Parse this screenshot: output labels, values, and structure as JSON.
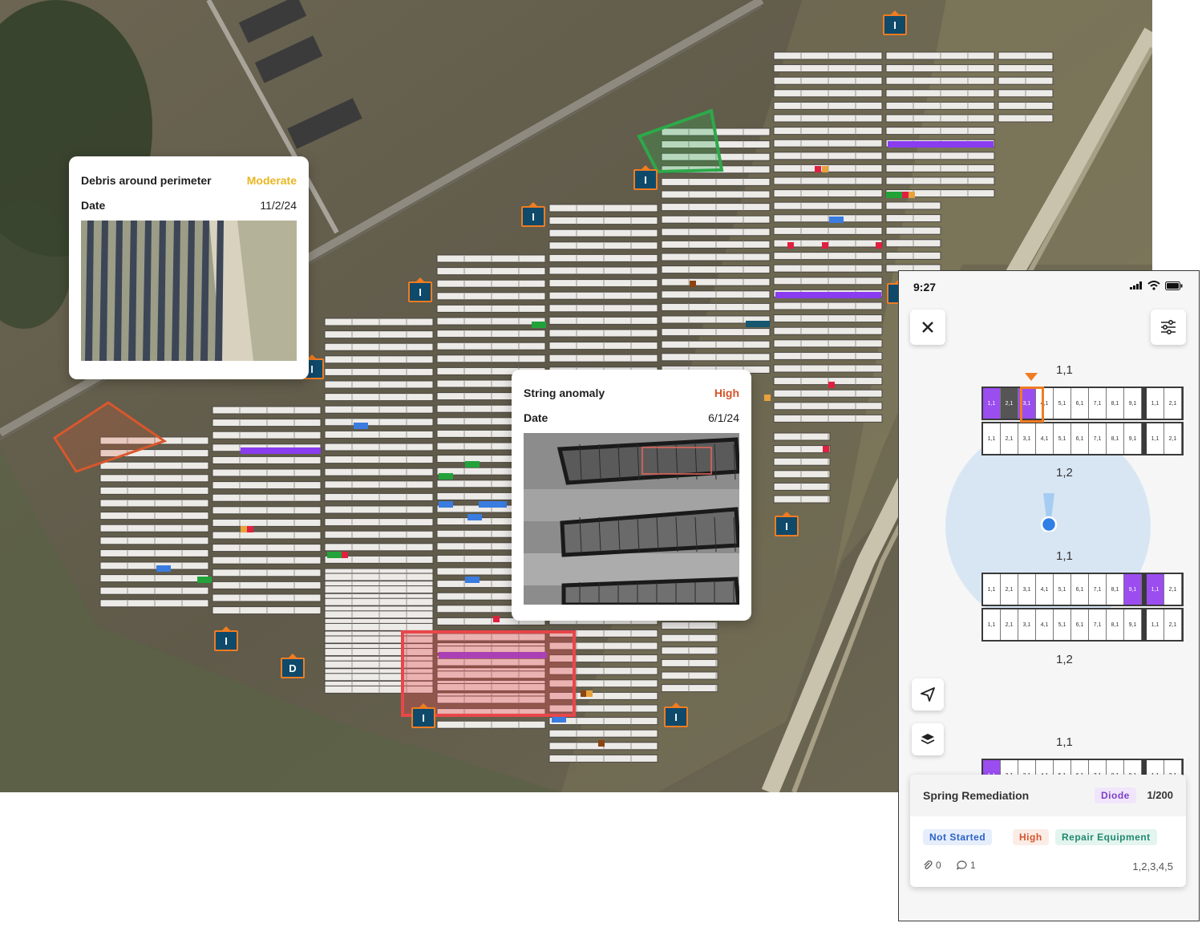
{
  "map": {
    "markers": [
      {
        "label": "I"
      },
      {
        "label": "I"
      },
      {
        "label": "I"
      },
      {
        "label": "I"
      },
      {
        "label": "I"
      },
      {
        "label": "I"
      },
      {
        "label": "I"
      },
      {
        "label": "I"
      },
      {
        "label": "I"
      },
      {
        "label": "D"
      },
      {
        "label": "I"
      },
      {
        "label": "I"
      }
    ]
  },
  "popup_debris": {
    "title": "Debris around perimeter",
    "severity": "Moderate",
    "severity_color": "#e8b622",
    "date_label": "Date",
    "date": "11/2/24"
  },
  "popup_string": {
    "title": "String anomaly",
    "severity": "High",
    "severity_color": "#d4552b",
    "date_label": "Date",
    "date": "6/1/24"
  },
  "phone": {
    "time": "9:27",
    "block_labels": [
      "1,1",
      "1,2",
      "1,1",
      "1,2",
      "1,1"
    ],
    "cells_top_row": [
      "1,1",
      "2,1",
      "3,1",
      "4,1",
      "5,1",
      "6,1",
      "7,1",
      "8,1",
      "9,1",
      "1,1",
      "2,1"
    ],
    "cells_row": [
      "1,1",
      "2,1",
      "3,1",
      "4,1",
      "5,1",
      "6,1",
      "7,1",
      "8,1",
      "9,1",
      "1,1",
      "2,1"
    ],
    "icons": {
      "close": "close-icon",
      "filter": "sliders-icon",
      "locate": "navigation-arrow-icon",
      "layers": "layers-icon"
    },
    "task": {
      "title": "Spring Remediation",
      "category": "Diode",
      "count": "1/200",
      "status": "Not Started",
      "priority": "High",
      "type": "Repair Equipment",
      "attachments": "0",
      "comments": "1",
      "rows": "1,2,3,4,5"
    }
  },
  "colors": {
    "marker_fill": "#0f4a6b",
    "marker_border": "#f07c21",
    "purple": "#9b4df0",
    "green_zone": "#2ea84a",
    "red_zone": "#e8474a",
    "orange_zone": "#d9572c"
  }
}
